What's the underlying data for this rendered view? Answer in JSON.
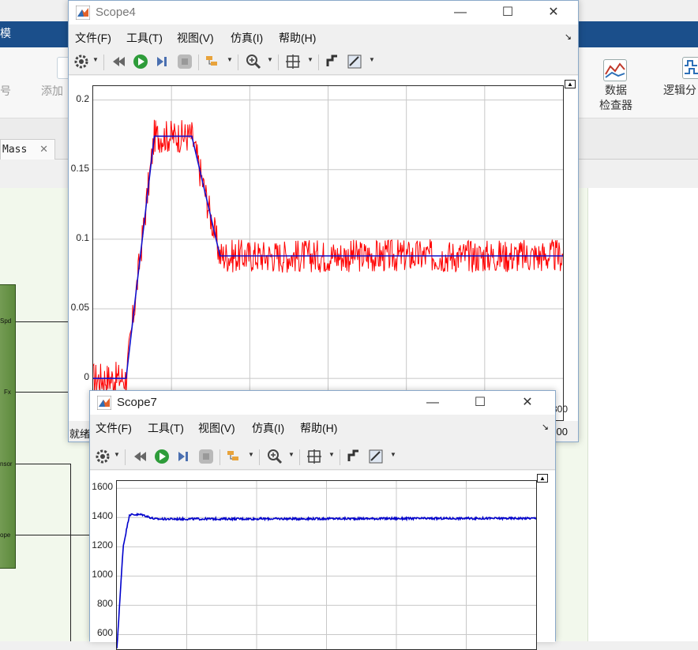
{
  "background_window": {
    "title_fragment": "模",
    "ribbon": {
      "left_fragment": "号",
      "add_fragment": "添加",
      "data_inspector_line1": "数据",
      "data_inspector_line2": "检查器",
      "logic_fragment": "逻辑分"
    },
    "model_tab": "Mass",
    "block_ports": [
      "Spd",
      "Fx",
      "nsor",
      "ope"
    ],
    "colors": {
      "titlebar": "#1b4f8b",
      "block": "#5d8a3c"
    }
  },
  "scope4": {
    "title": "Scope4",
    "menu": [
      "文件(F)",
      "工具(T)",
      "视图(V)",
      "仿真(I)",
      "帮助(H)"
    ],
    "status_left": "就绪",
    "status_right": "00",
    "xtick_partial": "300",
    "toolbar_icons": [
      "settings-icon",
      "rewind-icon",
      "run-icon",
      "step-forward-icon",
      "stop-icon",
      "highlight-icon",
      "zoom-in-icon",
      "fit-to-view-icon",
      "cursor-measure-icon",
      "triggers-icon"
    ]
  },
  "scope7": {
    "title": "Scope7",
    "menu": [
      "文件(F)",
      "工具(T)",
      "视图(V)",
      "仿真(I)",
      "帮助(H)"
    ],
    "toolbar_icons": [
      "settings-icon",
      "rewind-icon",
      "run-icon",
      "step-forward-icon",
      "stop-icon",
      "highlight-icon",
      "zoom-in-icon",
      "fit-to-view-icon",
      "cursor-measure-icon",
      "triggers-icon"
    ]
  },
  "chart_data": [
    {
      "type": "line",
      "title": "",
      "ylim": [
        -0.03,
        0.21
      ],
      "yticks": [
        "0.2",
        "0.15",
        "0.1",
        "0.05",
        "0"
      ],
      "ytick_values": [
        0.2,
        0.15,
        0.1,
        0.05,
        0
      ],
      "x_gridlines": 6,
      "grid": true,
      "series": [
        {
          "color": "#ff0000",
          "noise": 0.012,
          "x": [
            0,
            0.07,
            0.13,
            0.21,
            0.27,
            1.0
          ],
          "values": [
            0.0,
            0.0,
            0.174,
            0.174,
            0.088,
            0.088
          ]
        },
        {
          "color": "#1010cc",
          "noise": 0,
          "x": [
            0,
            0.07,
            0.13,
            0.21,
            0.27,
            1.0
          ],
          "values": [
            0.0,
            0.0,
            0.174,
            0.174,
            0.088,
            0.088
          ]
        }
      ]
    },
    {
      "type": "line",
      "title": "",
      "ylim": [
        500,
        1650
      ],
      "yticks": [
        "1600",
        "1400",
        "1200",
        "1000",
        "800",
        "600"
      ],
      "ytick_values": [
        1600,
        1400,
        1200,
        1000,
        800,
        600
      ],
      "x_gridlines": 6,
      "grid": true,
      "series": [
        {
          "color": "#0000cc",
          "noise": 7,
          "x": [
            0,
            0.015,
            0.03,
            0.06,
            0.09,
            1.0
          ],
          "values": [
            500,
            1200,
            1420,
            1420,
            1390,
            1395
          ]
        }
      ]
    }
  ]
}
